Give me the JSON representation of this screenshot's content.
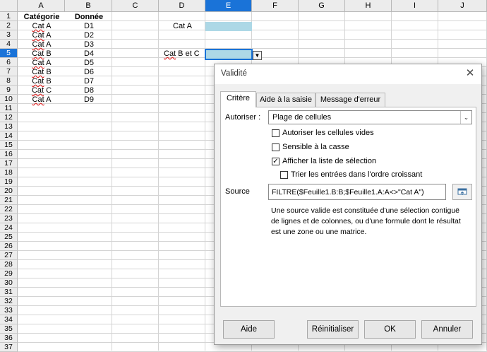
{
  "sheet": {
    "columns": [
      "A",
      "B",
      "C",
      "D",
      "E",
      "F",
      "G",
      "H",
      "I",
      "J"
    ],
    "rows": [
      "1",
      "2",
      "3",
      "4",
      "5",
      "6",
      "7",
      "8",
      "9",
      "10",
      "11",
      "12",
      "13",
      "14",
      "15",
      "16",
      "17",
      "18",
      "19",
      "20",
      "21",
      "22",
      "23",
      "24",
      "25",
      "26",
      "27",
      "28",
      "29",
      "30",
      "31",
      "32",
      "33",
      "34",
      "35",
      "36",
      "37"
    ],
    "selected_column": "E",
    "selected_row": "5",
    "header_a": "Catégorie",
    "header_b": "Donnée",
    "col_a": [
      "Cat A",
      "Cat A",
      "Cat A",
      "Cat B",
      "Cat A",
      "Cat B",
      "Cat B",
      "Cat C",
      "Cat A"
    ],
    "col_b": [
      "D1",
      "D2",
      "D3",
      "D4",
      "D5",
      "D6",
      "D7",
      "D8",
      "D9"
    ],
    "d2": "Cat A",
    "d5": "Cat B et C",
    "dropdown_icon": "dropdown-arrow-icon"
  },
  "dialog": {
    "title": "Validité",
    "tabs": [
      "Critère",
      "Aide à la saisie",
      "Message d'erreur"
    ],
    "active_tab": "Critère",
    "allow_label": "Autoriser :",
    "allow_value": "Plage de cellules",
    "checkboxes": {
      "allow_empty": {
        "label": "Autoriser les cellules vides",
        "checked": false
      },
      "case_sensitive": {
        "label": "Sensible à la casse",
        "checked": false
      },
      "show_list": {
        "label": "Afficher la liste de sélection",
        "checked": true
      },
      "sort_asc": {
        "label": "Trier les entrées dans l'ordre croissant",
        "checked": false
      }
    },
    "source_label": "Source",
    "source_value": "FILTRE($Feuille1.B:B;$Feuille1.A:A<>\"Cat A\")",
    "help_text": "Une source valide est constituée d'une sélection contiguë de lignes et de colonnes, ou d'une formule dont le résultat est une zone ou une matrice.",
    "buttons": {
      "help": "Aide",
      "reset": "Réinitialiser",
      "ok": "OK",
      "cancel": "Annuler"
    },
    "colors": {
      "selection": "#1a73d8",
      "highlight_cell": "#add8e6"
    }
  }
}
